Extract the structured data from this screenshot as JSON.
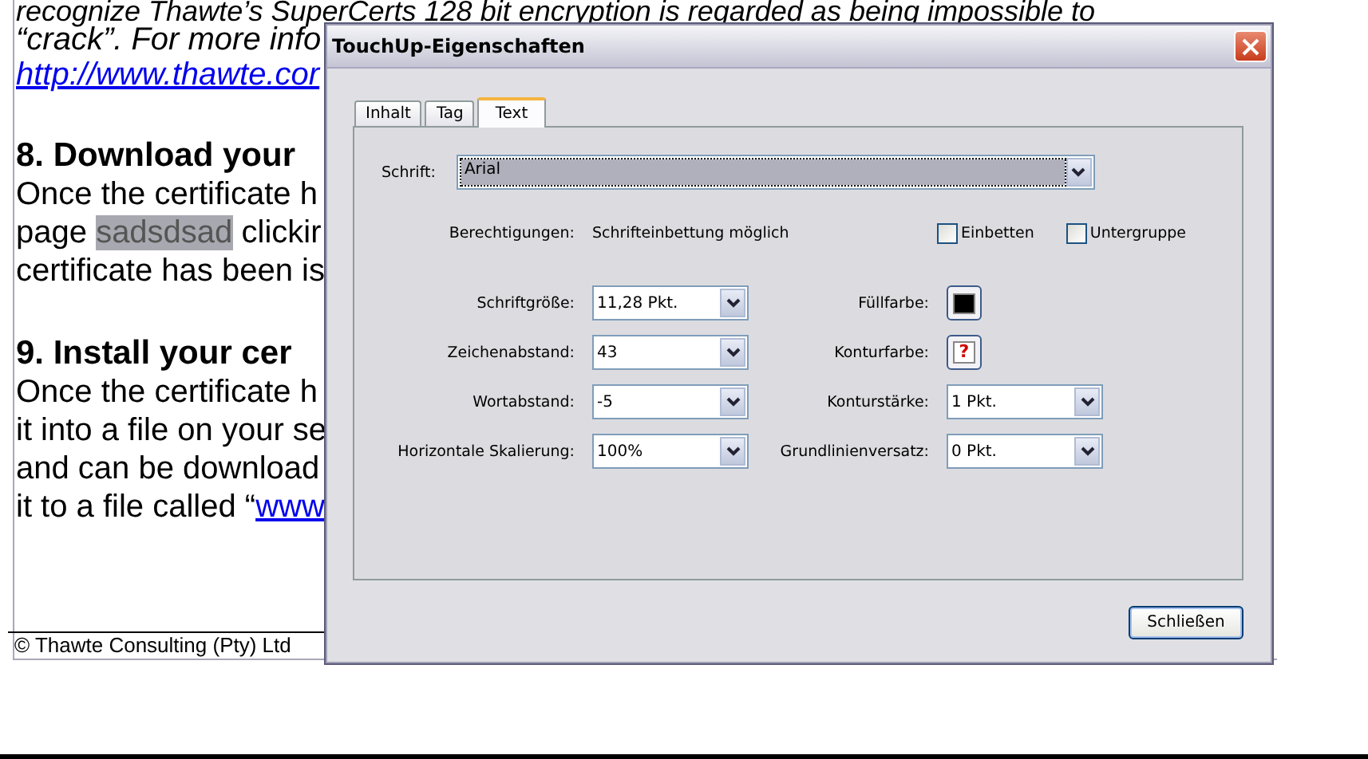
{
  "document": {
    "lines": [
      {
        "kind": "italic",
        "segments": [
          {
            "kind": "plain",
            "text": "recognize Thawte’s SuperCerts 128 bit encryption is regarded as being impossible to"
          }
        ]
      },
      {
        "kind": "italic",
        "segments": [
          {
            "kind": "plain",
            "text": "“crack”. For more info"
          }
        ]
      },
      {
        "kind": "italic",
        "segments": [
          {
            "kind": "link",
            "text": "http://www.thawte.cor"
          }
        ]
      },
      {
        "kind": "heading",
        "segments": [
          {
            "kind": "plain",
            "text": "8. Download your"
          }
        ]
      },
      {
        "kind": "body",
        "segments": [
          {
            "kind": "plain",
            "text": "Once the certificate h"
          }
        ]
      },
      {
        "kind": "body",
        "segments": [
          {
            "kind": "plain",
            "text": "page "
          },
          {
            "kind": "selected",
            "text": "sadsdsad"
          },
          {
            "kind": "plain",
            "text": " clickir"
          }
        ]
      },
      {
        "kind": "body",
        "segments": [
          {
            "kind": "plain",
            "text": "certificate has been is"
          }
        ]
      },
      {
        "kind": "heading",
        "segments": [
          {
            "kind": "plain",
            "text": "9. Install your cer"
          }
        ]
      },
      {
        "kind": "body",
        "segments": [
          {
            "kind": "plain",
            "text": "Once the certificate h"
          }
        ]
      },
      {
        "kind": "body",
        "segments": [
          {
            "kind": "plain",
            "text": "it into a file on your se"
          }
        ]
      },
      {
        "kind": "body",
        "segments": [
          {
            "kind": "plain",
            "text": "and can be download"
          }
        ]
      },
      {
        "kind": "body",
        "segments": [
          {
            "kind": "plain",
            "text": "it to a file called “"
          },
          {
            "kind": "link",
            "text": "www"
          }
        ]
      }
    ],
    "footer": "© Thawte Consulting (Pty) Ltd"
  },
  "dialog": {
    "title": "TouchUp-Eigenschaften",
    "tabs": [
      {
        "label": "Inhalt",
        "selected": false
      },
      {
        "label": "Tag",
        "selected": false
      },
      {
        "label": "Text",
        "selected": true
      }
    ],
    "font": {
      "label": "Schrift:",
      "value": "Arial"
    },
    "permissions": {
      "label": "Berechtigungen:",
      "value": "Schrifteinbettung möglich"
    },
    "checkboxes": [
      {
        "label": "Einbetten",
        "checked": false
      },
      {
        "label": "Untergruppe",
        "checked": false
      }
    ],
    "left_fields": [
      {
        "label": "Schriftgröße:",
        "value": "11,28 Pkt."
      },
      {
        "label": "Zeichenabstand:",
        "value": "43"
      },
      {
        "label": "Wortabstand:",
        "value": "-5"
      },
      {
        "label": "Horizontale Skalierung:",
        "value": "100%"
      }
    ],
    "right_fields": [
      {
        "kind": "color",
        "label": "Füllfarbe:",
        "color": "#000000"
      },
      {
        "kind": "mixed",
        "label": "Konturfarbe:",
        "symbol": "?"
      },
      {
        "kind": "dropdown",
        "label": "Konturstärke:",
        "value": "1 Pkt."
      },
      {
        "kind": "dropdown",
        "label": "Grundlinienversatz:",
        "value": "0 Pkt."
      }
    ],
    "close_button": "Schließen"
  }
}
